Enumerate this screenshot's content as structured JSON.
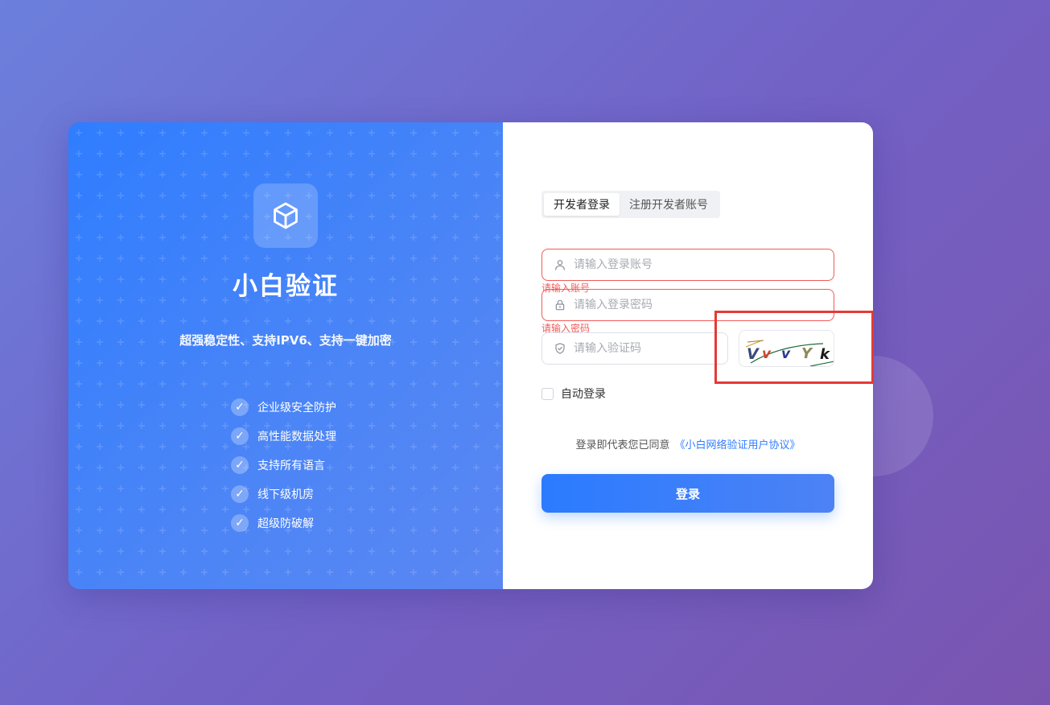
{
  "brand": {
    "name": "小白验证",
    "tagline": "超强稳定性、支持IPV6、支持一键加密",
    "logo_icon": "cube-icon",
    "features": [
      "企业级安全防护",
      "高性能数据处理",
      "支持所有语言",
      "线下级机房",
      "超级防破解"
    ]
  },
  "tabs": [
    {
      "label": "开发者登录",
      "active": true
    },
    {
      "label": "注册开发者账号",
      "active": false
    }
  ],
  "form": {
    "account": {
      "placeholder": "请输入登录账号",
      "value": "",
      "error": "请输入账号",
      "icon": "user-icon"
    },
    "password": {
      "placeholder": "请输入登录密码",
      "value": "",
      "error": "请输入密码",
      "icon": "lock-icon"
    },
    "captcha": {
      "placeholder": "请输入验证码",
      "value": "",
      "icon": "shield-icon",
      "image_text": "VvvYk"
    },
    "remember_label": "自动登录",
    "remember_checked": false
  },
  "agreement": {
    "prefix": "登录即代表您已同意",
    "link": "《小白网络验证用户协议》"
  },
  "login_button": "登录",
  "colors": {
    "primary": "#2f7dff",
    "error": "#f25b5b",
    "highlight": "#e53935"
  }
}
